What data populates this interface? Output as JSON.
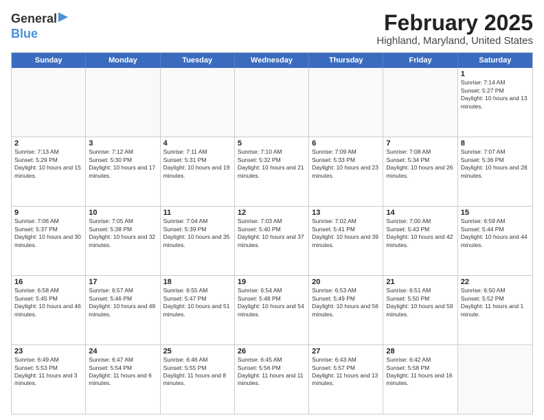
{
  "header": {
    "logo_general": "General",
    "logo_blue": "Blue",
    "title": "February 2025",
    "location": "Highland, Maryland, United States"
  },
  "calendar": {
    "weekdays": [
      "Sunday",
      "Monday",
      "Tuesday",
      "Wednesday",
      "Thursday",
      "Friday",
      "Saturday"
    ],
    "rows": [
      [
        {
          "day": "",
          "text": ""
        },
        {
          "day": "",
          "text": ""
        },
        {
          "day": "",
          "text": ""
        },
        {
          "day": "",
          "text": ""
        },
        {
          "day": "",
          "text": ""
        },
        {
          "day": "",
          "text": ""
        },
        {
          "day": "1",
          "text": "Sunrise: 7:14 AM\nSunset: 5:27 PM\nDaylight: 10 hours and 13 minutes."
        }
      ],
      [
        {
          "day": "2",
          "text": "Sunrise: 7:13 AM\nSunset: 5:29 PM\nDaylight: 10 hours and 15 minutes."
        },
        {
          "day": "3",
          "text": "Sunrise: 7:12 AM\nSunset: 5:30 PM\nDaylight: 10 hours and 17 minutes."
        },
        {
          "day": "4",
          "text": "Sunrise: 7:11 AM\nSunset: 5:31 PM\nDaylight: 10 hours and 19 minutes."
        },
        {
          "day": "5",
          "text": "Sunrise: 7:10 AM\nSunset: 5:32 PM\nDaylight: 10 hours and 21 minutes."
        },
        {
          "day": "6",
          "text": "Sunrise: 7:09 AM\nSunset: 5:33 PM\nDaylight: 10 hours and 23 minutes."
        },
        {
          "day": "7",
          "text": "Sunrise: 7:08 AM\nSunset: 5:34 PM\nDaylight: 10 hours and 26 minutes."
        },
        {
          "day": "8",
          "text": "Sunrise: 7:07 AM\nSunset: 5:36 PM\nDaylight: 10 hours and 28 minutes."
        }
      ],
      [
        {
          "day": "9",
          "text": "Sunrise: 7:06 AM\nSunset: 5:37 PM\nDaylight: 10 hours and 30 minutes."
        },
        {
          "day": "10",
          "text": "Sunrise: 7:05 AM\nSunset: 5:38 PM\nDaylight: 10 hours and 32 minutes."
        },
        {
          "day": "11",
          "text": "Sunrise: 7:04 AM\nSunset: 5:39 PM\nDaylight: 10 hours and 35 minutes."
        },
        {
          "day": "12",
          "text": "Sunrise: 7:03 AM\nSunset: 5:40 PM\nDaylight: 10 hours and 37 minutes."
        },
        {
          "day": "13",
          "text": "Sunrise: 7:02 AM\nSunset: 5:41 PM\nDaylight: 10 hours and 39 minutes."
        },
        {
          "day": "14",
          "text": "Sunrise: 7:00 AM\nSunset: 5:43 PM\nDaylight: 10 hours and 42 minutes."
        },
        {
          "day": "15",
          "text": "Sunrise: 6:59 AM\nSunset: 5:44 PM\nDaylight: 10 hours and 44 minutes."
        }
      ],
      [
        {
          "day": "16",
          "text": "Sunrise: 6:58 AM\nSunset: 5:45 PM\nDaylight: 10 hours and 46 minutes."
        },
        {
          "day": "17",
          "text": "Sunrise: 6:57 AM\nSunset: 5:46 PM\nDaylight: 10 hours and 49 minutes."
        },
        {
          "day": "18",
          "text": "Sunrise: 6:55 AM\nSunset: 5:47 PM\nDaylight: 10 hours and 51 minutes."
        },
        {
          "day": "19",
          "text": "Sunrise: 6:54 AM\nSunset: 5:48 PM\nDaylight: 10 hours and 54 minutes."
        },
        {
          "day": "20",
          "text": "Sunrise: 6:53 AM\nSunset: 5:49 PM\nDaylight: 10 hours and 56 minutes."
        },
        {
          "day": "21",
          "text": "Sunrise: 6:51 AM\nSunset: 5:50 PM\nDaylight: 10 hours and 59 minutes."
        },
        {
          "day": "22",
          "text": "Sunrise: 6:50 AM\nSunset: 5:52 PM\nDaylight: 11 hours and 1 minute."
        }
      ],
      [
        {
          "day": "23",
          "text": "Sunrise: 6:49 AM\nSunset: 5:53 PM\nDaylight: 11 hours and 3 minutes."
        },
        {
          "day": "24",
          "text": "Sunrise: 6:47 AM\nSunset: 5:54 PM\nDaylight: 11 hours and 6 minutes."
        },
        {
          "day": "25",
          "text": "Sunrise: 6:46 AM\nSunset: 5:55 PM\nDaylight: 11 hours and 8 minutes."
        },
        {
          "day": "26",
          "text": "Sunrise: 6:45 AM\nSunset: 5:56 PM\nDaylight: 11 hours and 11 minutes."
        },
        {
          "day": "27",
          "text": "Sunrise: 6:43 AM\nSunset: 5:57 PM\nDaylight: 11 hours and 13 minutes."
        },
        {
          "day": "28",
          "text": "Sunrise: 6:42 AM\nSunset: 5:58 PM\nDaylight: 11 hours and 16 minutes."
        },
        {
          "day": "",
          "text": ""
        }
      ]
    ]
  }
}
